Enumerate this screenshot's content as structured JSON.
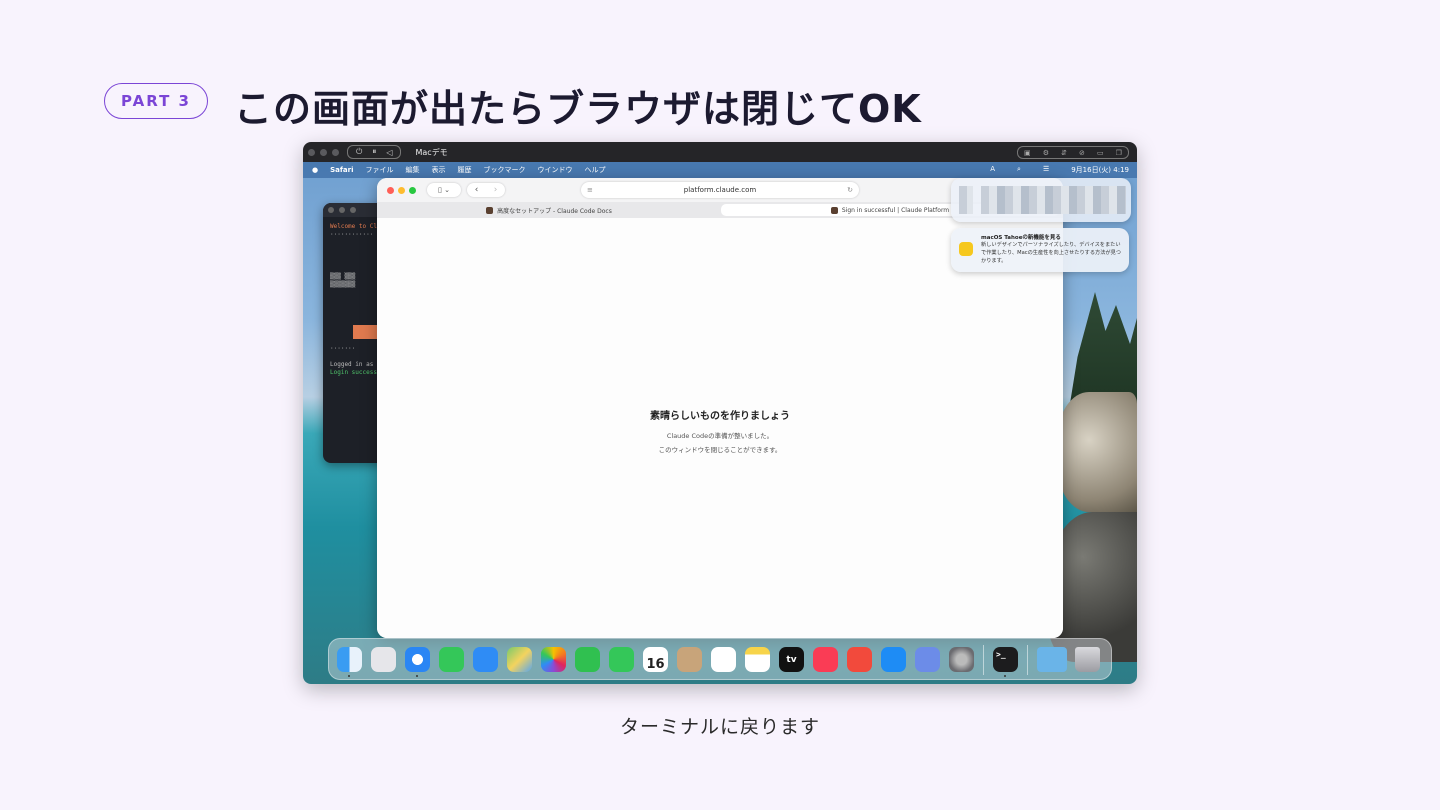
{
  "slide": {
    "part_label": "PART 3",
    "title": "この画面が出たらブラウザは閉じてOK",
    "caption": "ターミナルに戻ります",
    "accent": "#7b45d6",
    "background": "#f8f3fd"
  },
  "vm": {
    "title": "Macデモ"
  },
  "menubar": {
    "app": "Safari",
    "items": [
      "ファイル",
      "編集",
      "表示",
      "履歴",
      "ブックマーク",
      "ウインドウ",
      "ヘルプ"
    ],
    "input_indicator": "A",
    "clock": "9月16日(火) 4:19"
  },
  "terminal": {
    "lines": [
      "Welcome to Cl",
      "Logged in as",
      "Login success"
    ]
  },
  "safari": {
    "url": "platform.claude.com",
    "tabs": [
      {
        "label": "高度なセットアップ - Claude Code Docs"
      },
      {
        "label": "Sign in successful | Claude Platform"
      }
    ],
    "content": {
      "heading": "素晴らしいものを作りましょう",
      "line1": "Claude Codeの準備が整いました。",
      "line2": "このウィンドウを閉じることができます。"
    }
  },
  "notification": {
    "title": "macOS Tahoeの新機能を見る",
    "body": "新しいデザインでパーソナライズしたり、デバイスをまたいで作業したり、Macの生産性を向上させたりする方法が見つかります。"
  },
  "dock": {
    "icons": [
      "finder-icon",
      "launchpad-icon",
      "safari-icon",
      "messages-icon",
      "mail-icon",
      "maps-icon",
      "photos-icon",
      "facetime-icon",
      "phone-icon",
      "calendar-icon",
      "contacts-icon",
      "reminders-icon",
      "notes-icon",
      "tv-icon",
      "music-icon",
      "rocket-icon",
      "app-store-icon",
      "iphone-mirroring-icon",
      "system-settings-icon",
      "terminal-icon",
      "downloads-folder-icon",
      "trash-icon"
    ],
    "calendar_day": "16",
    "tv_label": "tv"
  }
}
